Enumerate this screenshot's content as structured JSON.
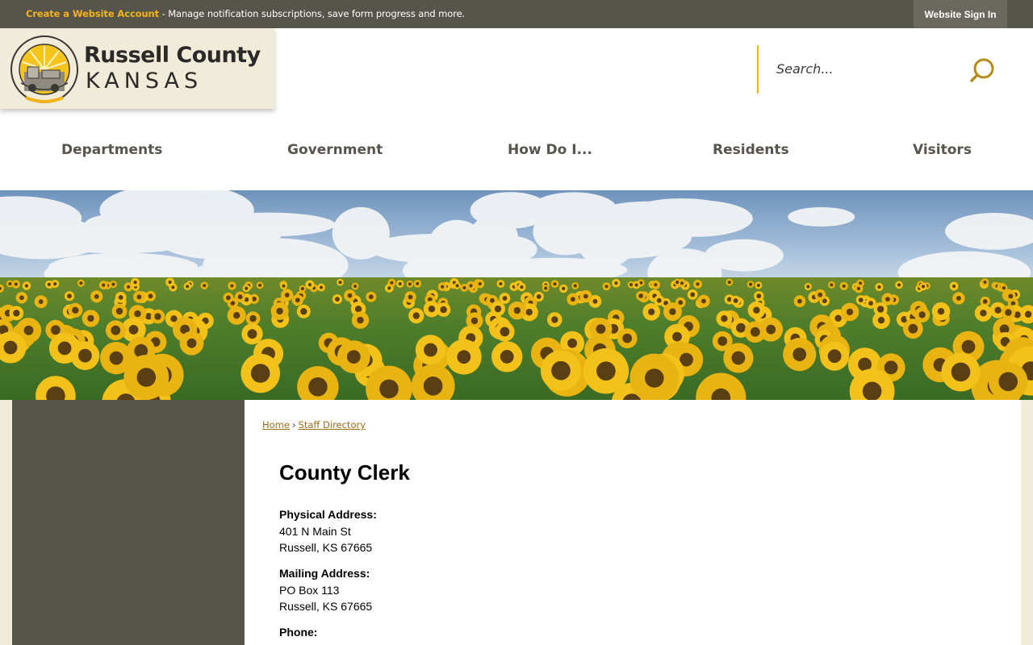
{
  "topbar": {
    "create_link": "Create a Website Account",
    "message": " - Manage notification subscriptions, save form progress and more.",
    "signin_label": "Website Sign In"
  },
  "logo": {
    "line1": "Russell County",
    "line2": "KANSAS"
  },
  "search": {
    "placeholder": "Search..."
  },
  "nav": {
    "items": [
      "Departments",
      "Government",
      "How Do I...",
      "Residents",
      "Visitors"
    ]
  },
  "breadcrumb": {
    "home": "Home",
    "separator": "›",
    "current": "Staff Directory"
  },
  "page": {
    "title": "County Clerk",
    "physical_label": "Physical Address:",
    "physical_line1": "401 N Main St",
    "physical_line2": "Russell, KS 67665",
    "mailing_label": "Mailing Address:",
    "mailing_line1": "PO Box 113",
    "mailing_line2": "Russell, KS 67665",
    "phone_label": "Phone:"
  },
  "colors": {
    "bar": "#57544b",
    "accent": "#f3b41b",
    "cream": "#f1ebd9",
    "link": "#9a6f15"
  },
  "icons": {
    "search": "search-icon",
    "seal": "county-seal-logo"
  }
}
